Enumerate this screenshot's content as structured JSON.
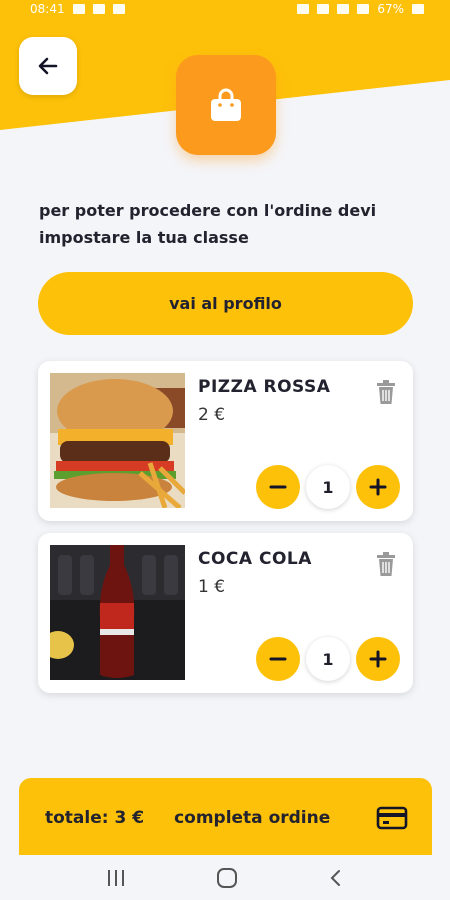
{
  "status_bar": {
    "time": "08:41",
    "battery": "67%"
  },
  "colors": {
    "accent_yellow": "#fdc10a",
    "bag_orange": "#fb9a1d",
    "background": "#f4f5f9"
  },
  "header": {
    "back_icon": "arrow-left-icon",
    "bag_icon": "shopping-bag-icon"
  },
  "notice": {
    "text": "per poter procedere con l'ordine devi impostare la tua classe"
  },
  "profile_button": {
    "label": "vai al profilo"
  },
  "cart_items": [
    {
      "name": "PIZZA ROSSA",
      "price": "2 €",
      "quantity": "1",
      "image": "burger-fries-photo"
    },
    {
      "name": "COCA COLA",
      "price": "1 €",
      "quantity": "1",
      "image": "coca-cola-bottle-photo"
    }
  ],
  "footer": {
    "total_label": "totale: 3 €",
    "complete_label": "completa ordine",
    "card_icon": "credit-card-icon"
  },
  "nav": {
    "recent_icon": "recent-apps-icon",
    "home_icon": "home-icon",
    "back_icon": "back-chevron-icon"
  }
}
